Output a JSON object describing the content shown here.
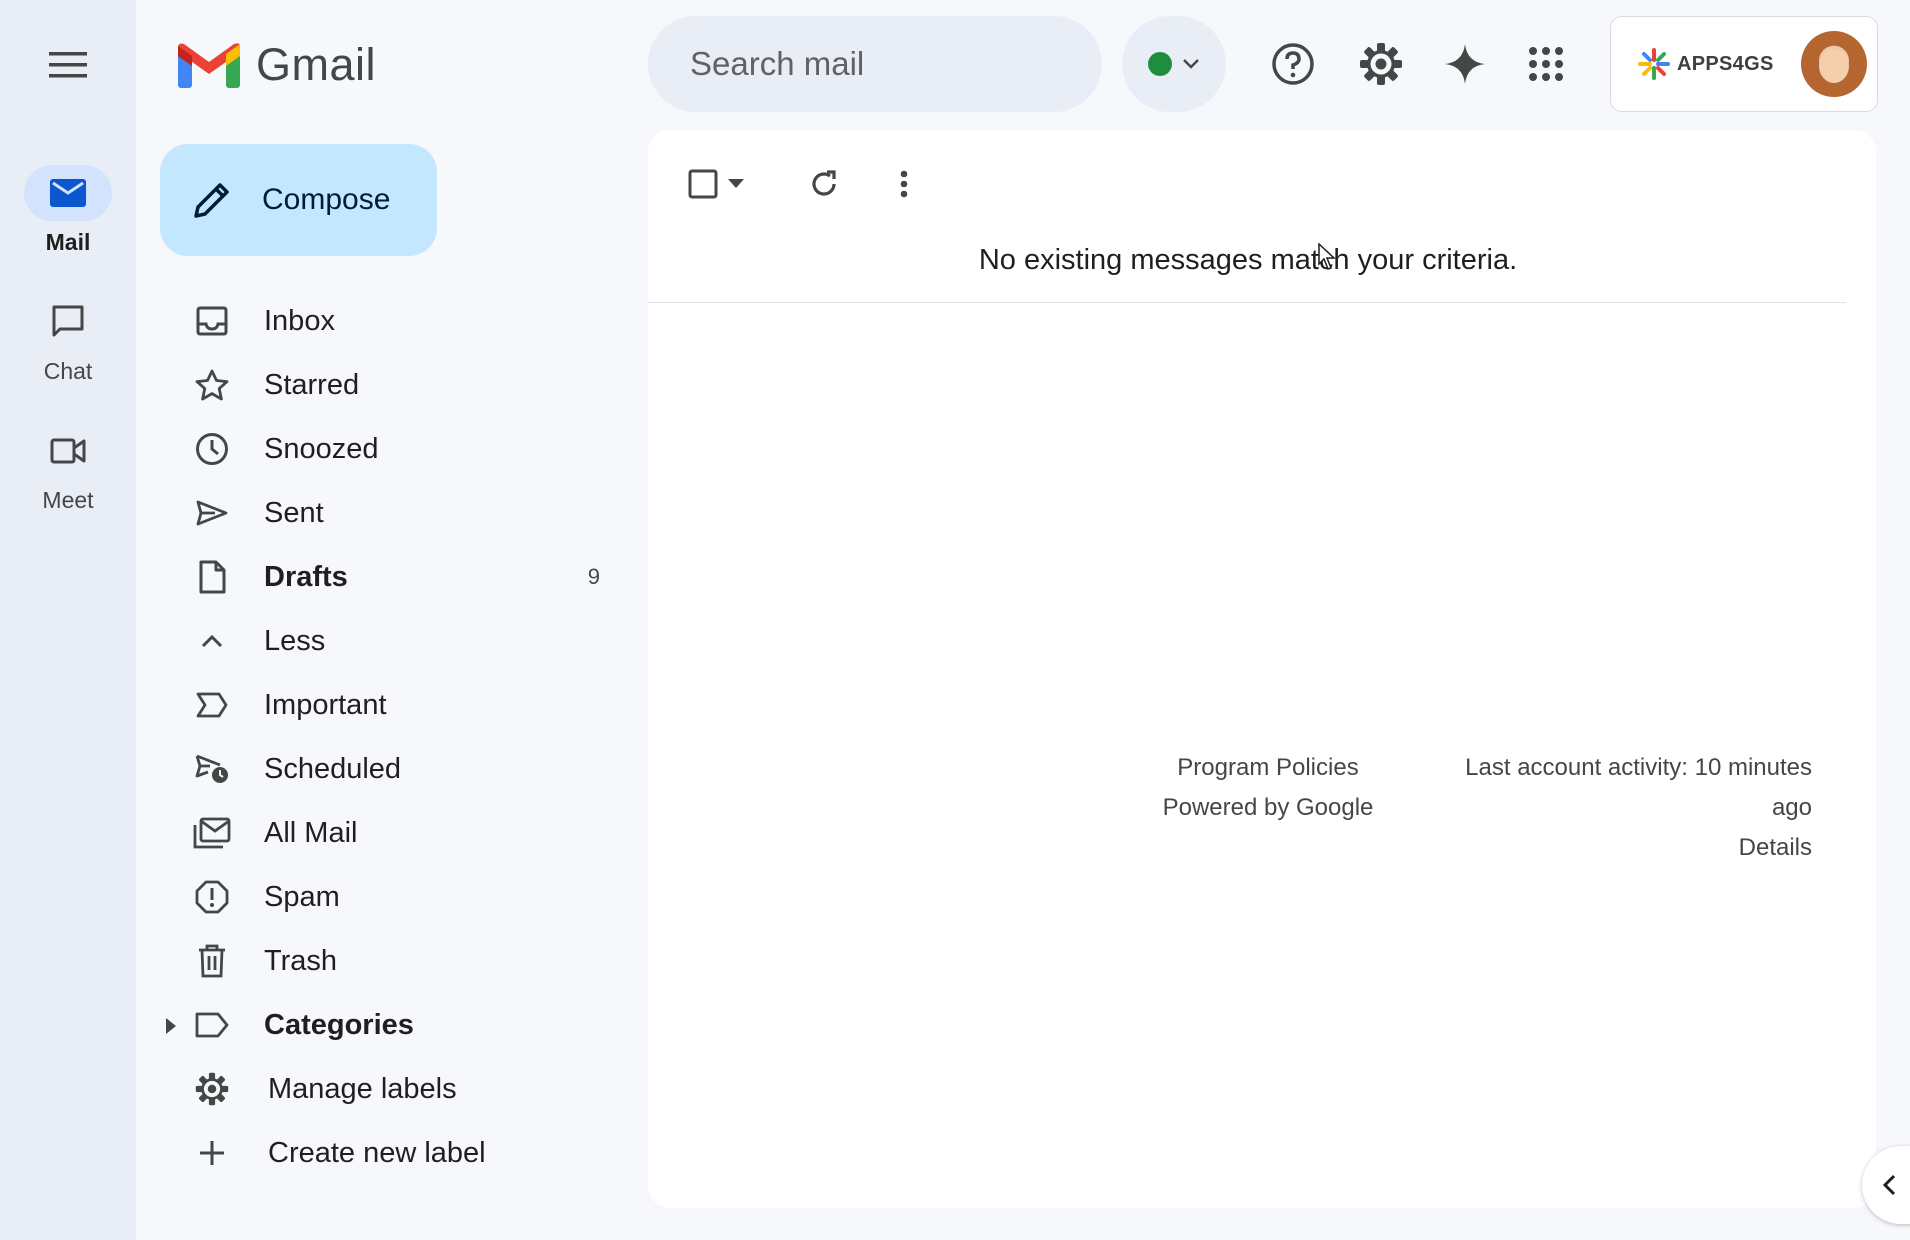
{
  "app": {
    "name": "Gmail"
  },
  "rail": {
    "items": [
      {
        "label": "Mail",
        "icon": "mail-icon",
        "active": true
      },
      {
        "label": "Chat",
        "icon": "chat-icon",
        "active": false
      },
      {
        "label": "Meet",
        "icon": "meet-icon",
        "active": false
      }
    ]
  },
  "search": {
    "placeholder": "Search mail"
  },
  "account": {
    "org": "APPS4GS"
  },
  "compose": {
    "label": "Compose"
  },
  "nav": {
    "items": [
      {
        "label": "Inbox",
        "icon": "inbox-icon"
      },
      {
        "label": "Starred",
        "icon": "star-icon"
      },
      {
        "label": "Snoozed",
        "icon": "clock-icon"
      },
      {
        "label": "Sent",
        "icon": "send-icon"
      },
      {
        "label": "Drafts",
        "icon": "draft-icon",
        "count": "9",
        "bold": true
      },
      {
        "label": "Less",
        "icon": "chevron-up-icon"
      },
      {
        "label": "Important",
        "icon": "important-icon"
      },
      {
        "label": "Scheduled",
        "icon": "scheduled-icon"
      },
      {
        "label": "All Mail",
        "icon": "all-mail-icon"
      },
      {
        "label": "Spam",
        "icon": "spam-icon"
      },
      {
        "label": "Trash",
        "icon": "trash-icon"
      },
      {
        "label": "Categories",
        "icon": "label-icon",
        "bold": true
      },
      {
        "label": "Manage labels",
        "icon": "gear-icon"
      },
      {
        "label": "Create new label",
        "icon": "plus-icon"
      }
    ]
  },
  "main": {
    "empty_message": "No existing messages match your criteria.",
    "footer": {
      "program_policies": "Program Policies",
      "powered_by": "Powered by Google",
      "activity_line1": "Last account activity: 10 minutes",
      "activity_line2": "ago",
      "details": "Details"
    }
  },
  "colors": {
    "background": "#f6f8fc",
    "rail_background": "#e9eef6",
    "compose_background": "#c2e7ff",
    "active_rail_pill": "#d3e3fd",
    "status_green": "#1e8e3e"
  }
}
